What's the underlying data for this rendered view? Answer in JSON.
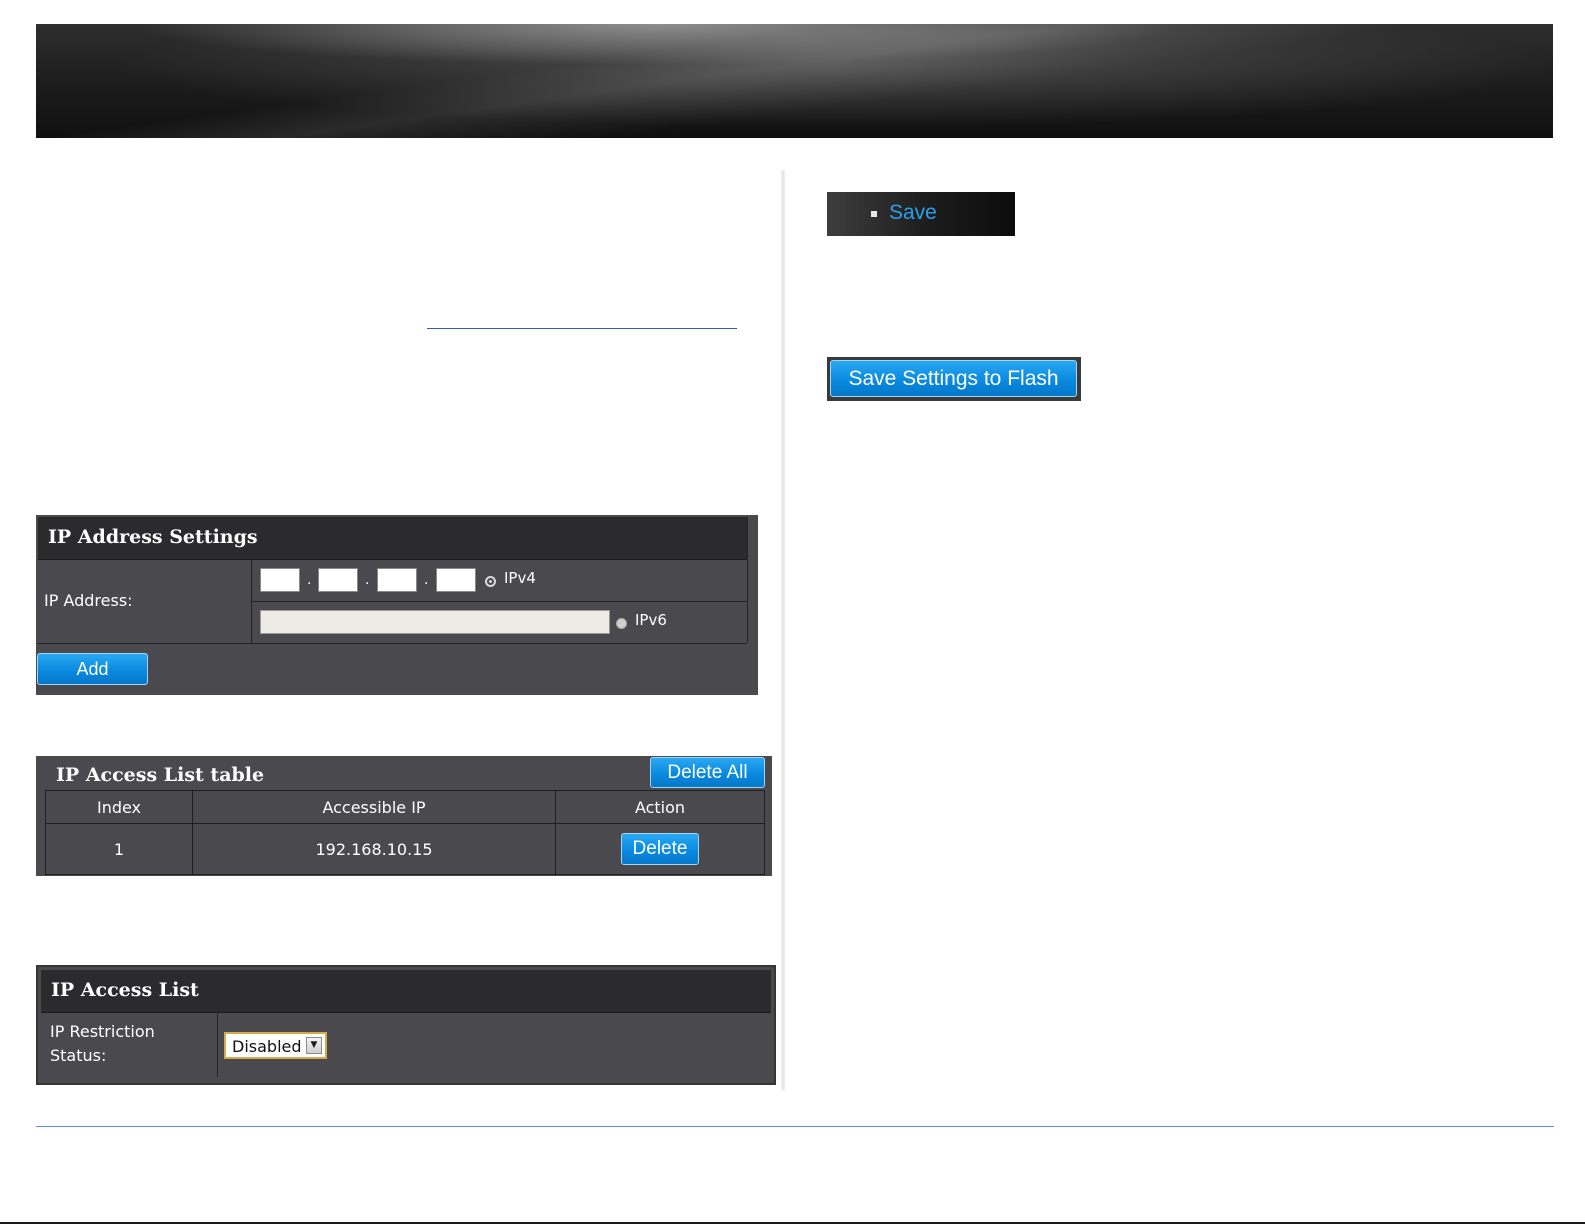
{
  "ip_address_settings": {
    "title": "IP Address Settings",
    "ip_address_label": "IP Address:",
    "ipv4_label": "IPv4",
    "ipv6_label": "IPv6",
    "ipv4_selected": true,
    "add_button": "Add"
  },
  "ip_access_list_table": {
    "title": "IP Access List table",
    "delete_all_button": "Delete All",
    "columns": [
      "Index",
      "Accessible IP",
      "Action"
    ],
    "rows": [
      {
        "index": "1",
        "accessible_ip": "192.168.10.15",
        "action": "Delete"
      }
    ]
  },
  "ip_access_list": {
    "title": "IP Access List",
    "restriction_label": "IP Restriction Status:",
    "restriction_value": "Disabled"
  },
  "save_menu": {
    "label": "Save"
  },
  "save_settings_button": "Save Settings to Flash",
  "colors": {
    "accent_blue": "#0a8ae0",
    "panel_bg": "#4a4a4e",
    "panel_header": "#2b2b2d",
    "link_rule": "#2f59c8",
    "footer_rule": "#5a8fd6"
  }
}
